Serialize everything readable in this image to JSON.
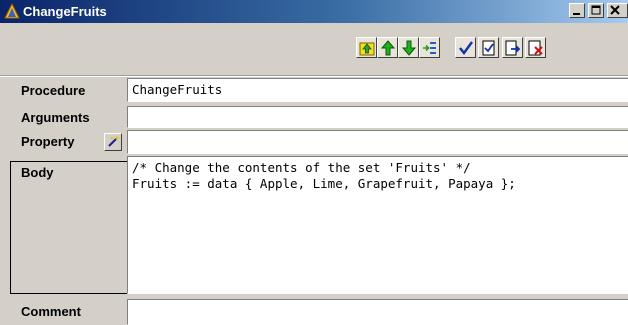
{
  "window": {
    "title": "ChangeFruits"
  },
  "toolbar": {
    "buttons": [
      {
        "name": "move-up-level-button",
        "icon": "folder-up-arrow-icon"
      },
      {
        "name": "move-up-button",
        "icon": "green-up-arrow-icon"
      },
      {
        "name": "move-down-button",
        "icon": "green-down-arrow-icon"
      },
      {
        "name": "insert-button",
        "icon": "insert-list-icon"
      },
      {
        "name": "check-button",
        "icon": "checkmark-icon"
      },
      {
        "name": "check-document-button",
        "icon": "document-check-icon"
      },
      {
        "name": "export-button",
        "icon": "document-arrow-icon"
      },
      {
        "name": "close-document-button",
        "icon": "document-x-icon"
      }
    ]
  },
  "form": {
    "procedure_label": "Procedure",
    "procedure_value": "ChangeFruits",
    "arguments_label": "Arguments",
    "arguments_value": "",
    "property_label": "Property",
    "property_value": "",
    "body_label": "Body",
    "body_value": "/* Change the contents of the set 'Fruits' */\nFruits := data { Apple, Lime, Grapefruit, Papaya };",
    "comment_label": "Comment",
    "comment_value": ""
  },
  "colors": {
    "title_start": "#0a246a",
    "title_end": "#a6caf0",
    "face": "#d4d0c8"
  }
}
